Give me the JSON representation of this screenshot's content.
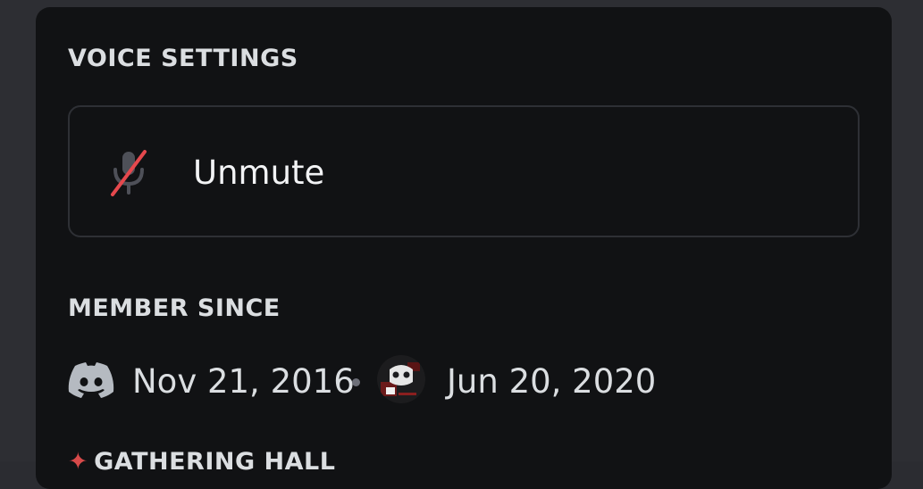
{
  "voice_settings": {
    "title": "VOICE SETTINGS",
    "unmute_label": "Unmute"
  },
  "member_since": {
    "title": "MEMBER SINCE",
    "discord_date": "Nov 21, 2016",
    "server_date": "Jun 20, 2020"
  },
  "next_section": {
    "title": "GATHERING HALL"
  },
  "icons": {
    "mic": "mic-muted-icon",
    "discord": "discord-logo-icon",
    "server": "server-avatar-icon"
  },
  "colors": {
    "panel_bg": "#111214",
    "backdrop": "#2d2e33",
    "muted_red": "#e5484d",
    "text": "#dbdee1"
  }
}
